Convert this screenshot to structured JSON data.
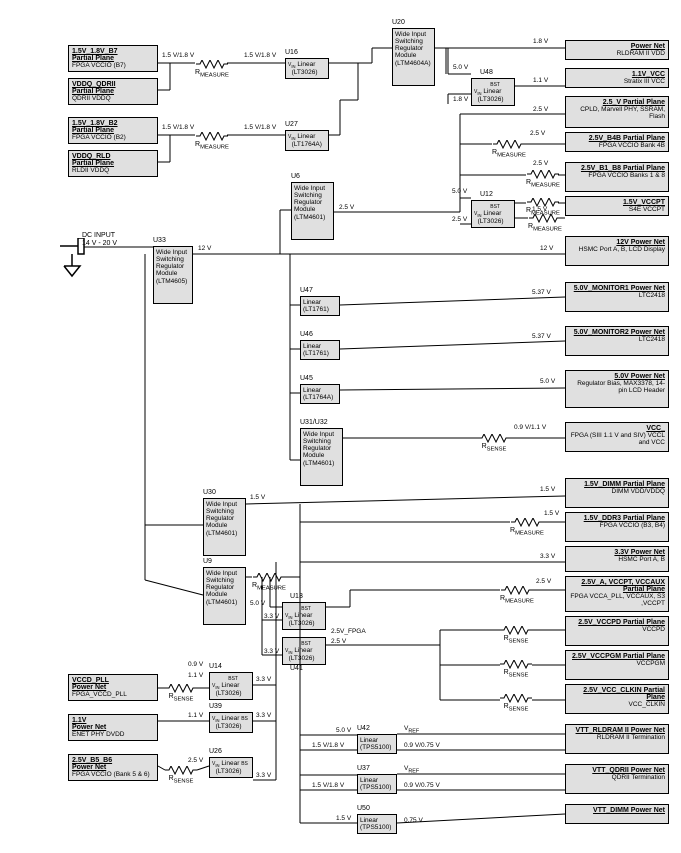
{
  "groups_left": {
    "g1": {
      "hdr": "1.5V_1.8V_B7",
      "sub1": "Partial Plane",
      "sub2": "FPGA VCCIO (B7)"
    },
    "g2": {
      "hdr": "VDDQ_QDRII",
      "sub1": "Partial Plane",
      "sub2": "QDRII VDDQ"
    },
    "g3": {
      "hdr": "1.5V_1.8V_B2",
      "sub1": "Partial Plane",
      "sub2": "FPGA VCCIO (B2)"
    },
    "g4": {
      "hdr": "VDDQ_RLD",
      "sub1": "Partial Plane",
      "sub2": "RLDII VDDQ"
    },
    "g5": {
      "hdr": "VCCD_PLL",
      "sub1": "Power Net",
      "sub2": "FPGA_VCCD_PLL"
    },
    "g6": {
      "hdr": "1.1V",
      "sub1": "Power Net",
      "sub2": "ENET PHY DVDD"
    },
    "g7": {
      "hdr": "2.5V_B5_B6",
      "sub1": "Power Net",
      "sub2": "FPGA VCCIO (Bank 5 & 6)"
    }
  },
  "wides": {
    "u33": {
      "name": "U33",
      "txt": "Wide Input Switching Regulator Module",
      "part": "(LTM4605)"
    },
    "u20": {
      "name": "U20",
      "txt": "Wide Input Switching Regulator Module",
      "part": "(LTM4604A)"
    },
    "u6": {
      "name": "U6",
      "txt": "Wide Input Switching Regulator Module",
      "part": "(LTM4601)"
    },
    "u30": {
      "name": "U30",
      "txt": "Wide Input Switching Regulator Module",
      "part": "(LTM4601)"
    },
    "u9": {
      "name": "U9",
      "txt": "Wide Input Switching Regulator Module",
      "part": "(LTM4601)"
    },
    "u31": {
      "name": "U31/U32",
      "txt": "Wide Input Switching Regulator Module",
      "part": "(LTM4601)"
    }
  },
  "regs": {
    "u16": {
      "name": "U16",
      "txt": "Linear",
      "part": "(LT3026)"
    },
    "u27": {
      "name": "U27",
      "txt": "Linear",
      "part": "(LT1764A)"
    },
    "u48": {
      "name": "U48",
      "txt": "Linear",
      "part": "(LT3026)"
    },
    "u12": {
      "name": "U12",
      "txt": "Linear",
      "part": "(LT3026)"
    },
    "u47": {
      "name": "U47",
      "txt": "Linear",
      "part": "(LT1761)"
    },
    "u46": {
      "name": "U46",
      "txt": "Linear",
      "part": "(LT1761)"
    },
    "u45": {
      "name": "U45",
      "txt": "Linear",
      "part": "(LT1764A)"
    },
    "u14": {
      "name": "U14",
      "txt": "Linear",
      "part": "(LT3026)"
    },
    "u39": {
      "name": "U39",
      "txt": "Linear",
      "part": "(LT3026)"
    },
    "u26": {
      "name": "U26",
      "txt": "Linear",
      "part": "(LT3026)"
    },
    "u13": {
      "name": "U13",
      "txt": "Linear",
      "part": "(LT3026)"
    },
    "u41": {
      "name": "U41",
      "txt": "Linear",
      "part": "(LT3026)"
    },
    "u42": {
      "name": "U42",
      "txt": "Linear",
      "part": "(TPS5100)"
    },
    "u37": {
      "name": "U37",
      "txt": "Linear",
      "part": "(TPS5100)"
    },
    "u50": {
      "name": "U50",
      "txt": "Linear",
      "part": "(TPS5100)"
    }
  },
  "ends": {
    "e1": {
      "hdr": "Power Net",
      "sub": "RLDRAM II VDD"
    },
    "e2": {
      "hdr": "1.1V_VCC",
      "sub": "Stratix III VCC"
    },
    "e3": {
      "hdr": "2.5_V Partial Plane",
      "sub": "CPLD, Marvell PHY, SSRAM, Flash"
    },
    "e4": {
      "hdr": "2.5V_B4B Partial Plane",
      "sub": "FPGA VCCIO Bank 4B"
    },
    "e5": {
      "hdr": "2.5V_B1_B8 Partial Plane",
      "sub": "FPGA VCCIO Banks 1 & 8"
    },
    "e6": {
      "hdr": "1.5V_VCCPT",
      "sub": "S4E VCCPT"
    },
    "e7": {
      "hdr": "12V Power Net",
      "sub": "HSMC Port A, B, LCD Display"
    },
    "e8": {
      "hdr": "5.0V_MONITOR1 Power Net",
      "sub": "LTC2418"
    },
    "e9": {
      "hdr": "5.0V_MONITOR2 Power Net",
      "sub": "LTC2418"
    },
    "e10": {
      "hdr": "5.0V Power Net",
      "sub": "Regulator Bias, MAX3378, 14-pin LCD Header"
    },
    "e11": {
      "hdr": "VCC_",
      "sub": "FPGA (SIII 1.1 V and SIV) VCCL and VCC"
    },
    "e12": {
      "hdr": "1.5V_DIMM Partial Plane",
      "sub": "DIMM VDD/VDDQ"
    },
    "e13": {
      "hdr": "1.5V_DDR3 Partial Plane",
      "sub": "FPGA VCCIO (B3, B4)"
    },
    "e14": {
      "hdr": "3.3V Power Net",
      "sub": "HSMC Port A, B"
    },
    "e15": {
      "hdr": "2.5V_A, VCCPT, VCCAUX Partial Plane",
      "sub": "FPGA VCCA_PLL, VCCAUX, S3 ,VCCPT"
    },
    "e16": {
      "hdr": "2.5V_VCCPD Partial Plane",
      "sub": "VCCPD"
    },
    "e17": {
      "hdr": "2.5V_VCCPGM Partial Plane",
      "sub": "VCCPGM"
    },
    "e18": {
      "hdr": "2.5V_VCC_CLKIN Partial Plane",
      "sub": "VCC_CLKIN"
    },
    "e19": {
      "hdr": "VTT_RLDRAM II Power Net",
      "sub": "RLDRAM II Termination"
    },
    "e20": {
      "hdr": "VTT_QDRII Power Net",
      "sub": "QDRII Termination"
    },
    "e21": {
      "hdr": "VTT_DIMM Power Net",
      "sub": ""
    }
  },
  "labels": {
    "dc": "DC INPUT 14 V - 20 V",
    "v15v18": "1.5 V/1.8 V",
    "v1p8": "1.8 V",
    "v2p5": "2.5 V",
    "v5p0": "5.0 V",
    "v1p1": "1.1 V",
    "v1p5": "1.5 V",
    "v12": "12 V",
    "v5p37": "5.37 V",
    "v0p9_1p1": "0.9 V/1.1 V",
    "v3p3": "3.3 V",
    "v0p9_0p75": "0.9 V/0.75 V",
    "v0p75": "0.75 V",
    "v2p5f": "2.5V_FPGA",
    "v0p9": "0.9 V",
    "rm": "R",
    "rms": "MEASURE",
    "rs": "SENSE",
    "vref": "V",
    "vrefsub": "REF",
    "bst": "BST",
    "vin": "V<sub>IN</sub>",
    "bs": "BS"
  }
}
